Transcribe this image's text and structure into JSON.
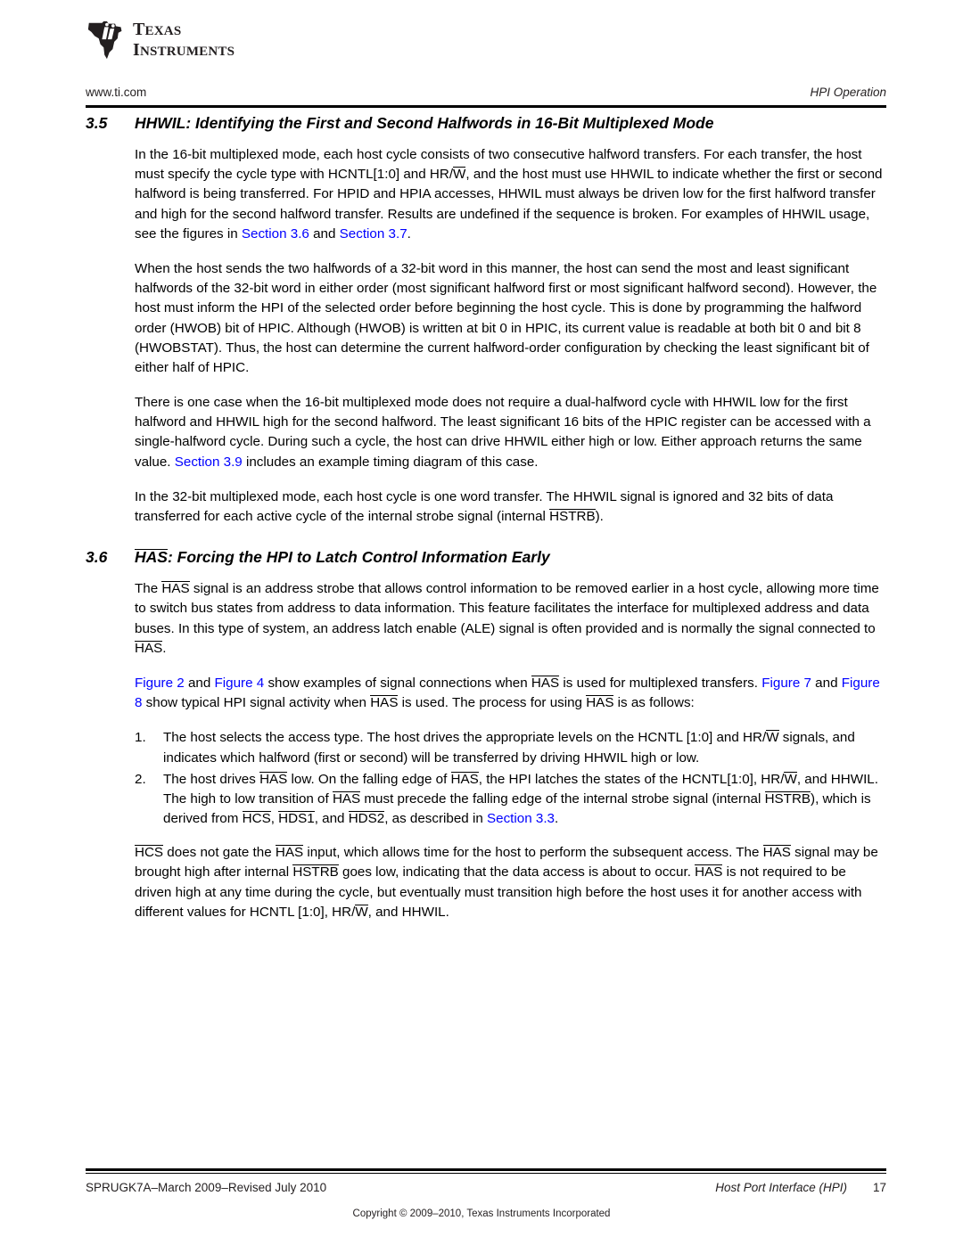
{
  "brand": {
    "logo_icon": "ti-texas-logo-icon",
    "line1": "TEXAS",
    "line2": "INSTRUMENTS"
  },
  "header": {
    "url": "www.ti.com",
    "running_head": "HPI Operation"
  },
  "sections": [
    {
      "number": "3.5",
      "title": "HHWIL: Identifying the First and Second Halfwords in 16-Bit Multiplexed Mode"
    },
    {
      "number": "3.6",
      "title_overline": "HAS",
      "title_rest": ": Forcing the HPI to Latch Control Information Early"
    }
  ],
  "paragraphs": {
    "p1": {
      "a": "In the 16-bit multiplexed mode, each host cycle consists of two consecutive halfword transfers. For each transfer, the host must specify the cycle type with HCNTL[1:0] and HR/",
      "ovl1": "W",
      "b": ", and the host must use HHWIL to indicate whether the first or second halfword is being transferred. For HPID and HPIA accesses, HHWIL must always be driven low for the first halfword transfer and high for the second halfword transfer. Results are undefined if the sequence is broken. For examples of HHWIL usage, see the figures in ",
      "link1": "Section 3.6",
      "c": " and ",
      "link2": "Section 3.7",
      "d": "."
    },
    "p2": "When the host sends the two halfwords of a 32-bit word in this manner, the host can send the most and least significant halfwords of the 32-bit word in either order (most significant halfword first or most significant halfword second). However, the host must inform the HPI of the selected order before beginning the host cycle. This is done by programming the halfword order (HWOB) bit of HPIC. Although (HWOB) is written at bit 0 in HPIC, its current value is readable at both bit 0 and bit 8 (HWOBSTAT). Thus, the host can determine the current halfword-order configuration by checking the least significant bit of either half of HPIC.",
    "p3": {
      "a": "There is one case when the 16-bit multiplexed mode does not require a dual-halfword cycle with HHWIL low for the first halfword and HHWIL high for the second halfword. The least significant 16 bits of the HPIC register can be accessed with a single-halfword cycle. During such a cycle, the host can drive HHWIL either high or low. Either approach returns the same value. ",
      "link1": "Section 3.9",
      "b": " includes an example timing diagram of this case."
    },
    "p4": {
      "a": "In the 32-bit multiplexed mode, each host cycle is one word transfer. The HHWIL signal is ignored and 32 bits of data transferred for each active cycle of the internal strobe signal (internal ",
      "ovl1": "HSTRB",
      "b": ")."
    },
    "p5": {
      "a": "The ",
      "ovl1": "HAS",
      "b": " signal is an address strobe that allows control information to be removed earlier in a host cycle, allowing more time to switch bus states from address to data information. This feature facilitates the interface for multiplexed address and data buses. In this type of system, an address latch enable (ALE) signal is often provided and is normally the signal connected to ",
      "ovl2": "HAS",
      "c": "."
    },
    "p6": {
      "link1": "Figure 2",
      "a": " and ",
      "link2": "Figure 4",
      "b": " show examples of signal connections when ",
      "ovl1": "HAS",
      "c": " is used for multiplexed transfers. ",
      "link3": "Figure 7",
      "d": " and ",
      "link4": "Figure 8",
      "e": " show typical HPI signal activity when ",
      "ovl2": "HAS",
      "f": " is used. The process for using ",
      "ovl3": "HAS",
      "g": " is as follows:"
    },
    "p7": {
      "a": "",
      "ovl1": "HCS",
      "b": " does not gate the ",
      "ovl2": "HAS",
      "c": " input, which allows time for the host to perform the subsequent access. The ",
      "ovl3": "HAS",
      "d": " signal may be brought high after internal ",
      "ovl4": "HSTRB",
      "e": " goes low, indicating that the data access is about to occur. ",
      "ovl5": "HAS",
      "f": " is not required to be driven high at any time during the cycle, but eventually must transition high before the host uses it for another access with different values for HCNTL [1:0], HR/",
      "ovl6": "W",
      "g": ", and HHWIL."
    }
  },
  "steps": [
    {
      "num": "1.",
      "a": "The host selects the access type. The host drives the appropriate levels on the HCNTL [1:0] and HR/",
      "ovl1": "W",
      "b": " signals, and indicates which halfword (first or second) will be transferred by driving HHWIL high or low."
    },
    {
      "num": "2.",
      "a": "The host drives ",
      "ovl1": "HAS",
      "b": " low. On the falling edge of ",
      "ovl2": "HAS",
      "c": ", the HPI latches the states of the HCNTL[1:0], HR/",
      "ovl3": "W",
      "d": ", and HHWIL. The high to low transition of ",
      "ovl4": "HAS",
      "e": " must precede the falling edge of the internal strobe signal (internal ",
      "ovl5": "HSTRB",
      "f": "), which is derived from ",
      "ovl6": "HCS",
      "g": ", ",
      "ovl7": "HDS1",
      "h": ", and ",
      "ovl8": "HDS2",
      "i": ", as described in ",
      "link1": "Section 3.3",
      "j": "."
    }
  ],
  "footer": {
    "doc_id": "SPRUGK7A–March 2009–Revised July 2010",
    "running_title": "Host Port Interface (HPI)",
    "page_number": "17",
    "copyright": "Copyright © 2009–2010, Texas Instruments Incorporated"
  },
  "colors": {
    "link": "#0000ff",
    "text": "#000000",
    "rule": "#000000"
  }
}
